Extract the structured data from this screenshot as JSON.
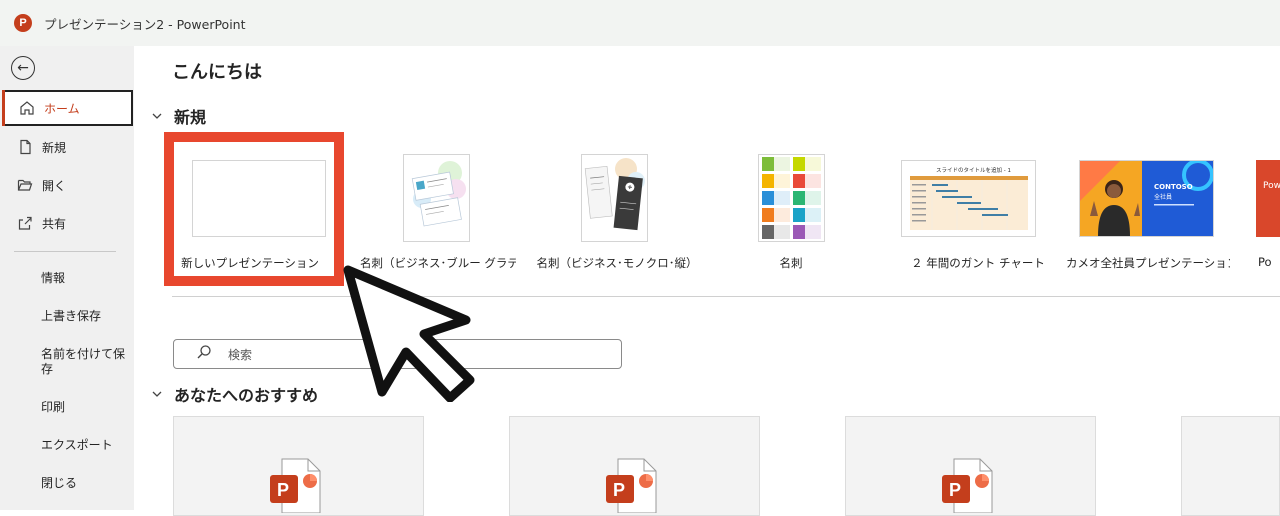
{
  "window": {
    "app_logo": "P",
    "title": "プレゼンテーション2 - PowerPoint"
  },
  "sidebar": {
    "back_label": "←",
    "items": [
      {
        "label": "ホーム",
        "icon": "home-icon",
        "active": true
      },
      {
        "label": "新規",
        "icon": "new-file-icon"
      },
      {
        "label": "開く",
        "icon": "folder-open-icon"
      },
      {
        "label": "共有",
        "icon": "share-icon"
      }
    ],
    "sub_items": [
      "情報",
      "上書き保存",
      "名前を付けて保存",
      "印刷",
      "エクスポート",
      "閉じる"
    ]
  },
  "main": {
    "greeting": "こんにちは",
    "new_section": "新規",
    "templates": [
      "新しいプレゼンテーション",
      "名刺（ビジネス･ブルー グラデ…",
      "名刺（ビジネス･モノクロ･縦）",
      "名刺",
      "２ 年間のガント チャート",
      "カメオ全社員プレゼンテーション",
      "Po"
    ],
    "gantt_title": "スライドのタイトルを追加 - 1",
    "contoso_title": "CONTOSO",
    "contoso_sub": "全社員",
    "red_thumb_text": "Powe",
    "search_placeholder": "検索",
    "recommended_section": "あなたへのおすすめ"
  },
  "colors": {
    "accent": "#c43e1c",
    "highlight": "#e8472e"
  }
}
